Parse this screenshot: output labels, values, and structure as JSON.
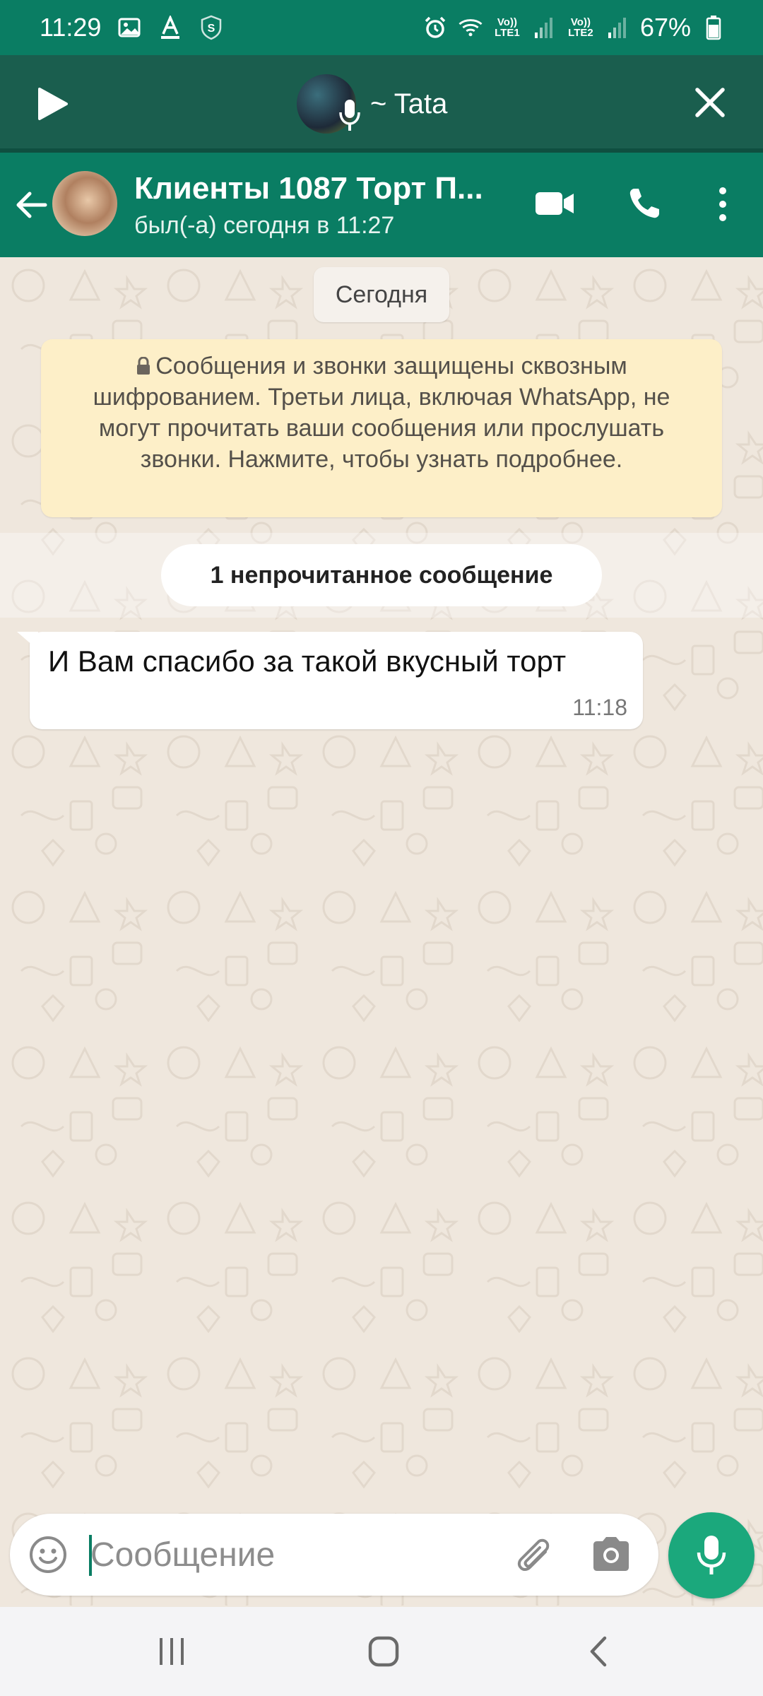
{
  "status_bar": {
    "time": "11:29",
    "battery": "67%",
    "sim1_label": "Vo)) LTE1",
    "sim2_label": "Vo)) LTE2",
    "icons": [
      "gallery-icon",
      "text-a-icon",
      "shield-s-icon",
      "alarm-icon",
      "wifi-icon",
      "signal-icon",
      "battery-icon"
    ]
  },
  "voice_bar": {
    "sender": "~ Tata",
    "icons": [
      "play-icon",
      "mic-icon",
      "close-icon"
    ]
  },
  "header": {
    "contact_name": "Клиенты 1087 Торт П...",
    "last_seen": "был(-а) сегодня в 11:27",
    "icons": [
      "back-arrow-icon",
      "video-call-icon",
      "phone-call-icon",
      "more-vert-icon"
    ]
  },
  "chat": {
    "date_label": "Сегодня",
    "encryption_notice": "Сообщения и звонки защищены сквозным шифрованием. Третьи лица, включая WhatsApp, не могут прочитать ваши сообщения или прослушать звонки. Нажмите, чтобы узнать подробнее.",
    "unread_label": "1 непрочитанное сообщение",
    "messages": [
      {
        "text": "И Вам спасибо за такой вкусный торт",
        "time": "11:18",
        "direction": "incoming"
      }
    ]
  },
  "composer": {
    "placeholder": "Сообщение",
    "value": "",
    "icons": [
      "emoji-icon",
      "paperclip-icon",
      "camera-icon",
      "mic-icon"
    ]
  },
  "nav_bar": {
    "icons": [
      "recent-apps-icon",
      "home-icon",
      "back-icon"
    ]
  },
  "colors": {
    "primary": "#0a7d63",
    "voice_bar": "#1a5e4e",
    "accent": "#1ba87c",
    "chat_background": "#efe7dd",
    "notice_background": "#fdefc8"
  }
}
